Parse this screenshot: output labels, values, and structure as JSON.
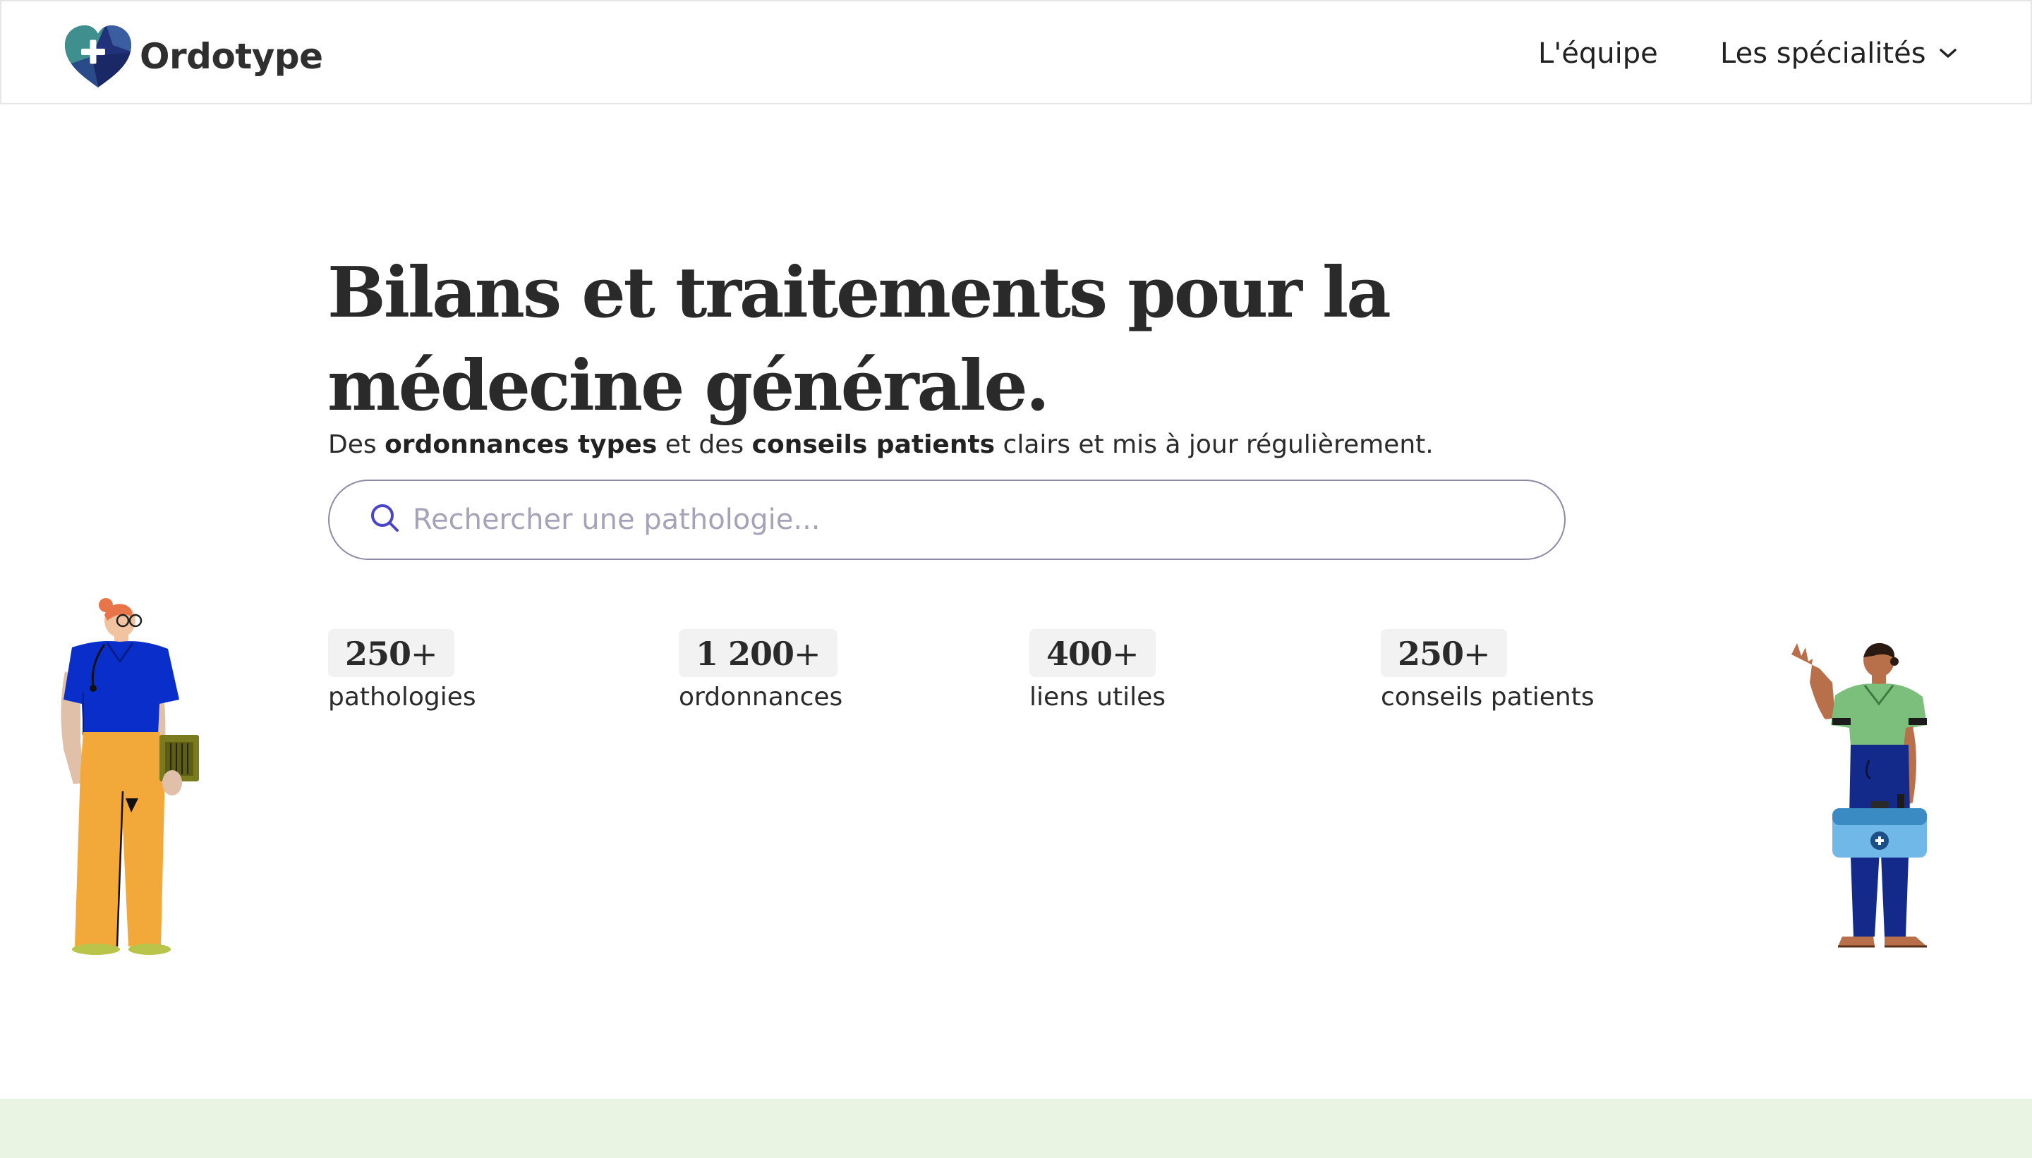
{
  "brand": {
    "name": "Ordotype",
    "logo_icon": "heart-cross-logo",
    "colors": {
      "teal": "#3f8f8e",
      "navy": "#22327a",
      "accent": "#4a44c6",
      "band": "#eaf4e2"
    }
  },
  "nav": {
    "team_label": "L'équipe",
    "specialties_label": "Les spécialités",
    "specialties_icon": "chevron-down-icon"
  },
  "hero": {
    "title": "Bilans et traitements pour la médecine générale.",
    "subtitle": {
      "part1": "Des ",
      "bold1": "ordonnances types",
      "part2": " et des ",
      "bold2": "conseils patients",
      "part3": " clairs et mis à jour régulièrement."
    },
    "search": {
      "placeholder": "Rechercher une pathologie...",
      "value": "",
      "icon": "search-icon"
    }
  },
  "stats": [
    {
      "value": "250",
      "suffix": "+",
      "label": "pathologies"
    },
    {
      "value": "1 200",
      "suffix": "+",
      "label": "ordonnances"
    },
    {
      "value": "400",
      "suffix": "+",
      "label": "liens utiles"
    },
    {
      "value": "250",
      "suffix": "+",
      "label": "conseils patients"
    }
  ],
  "illustrations": {
    "left": "doctor-illustration",
    "right": "paramedic-illustration"
  }
}
